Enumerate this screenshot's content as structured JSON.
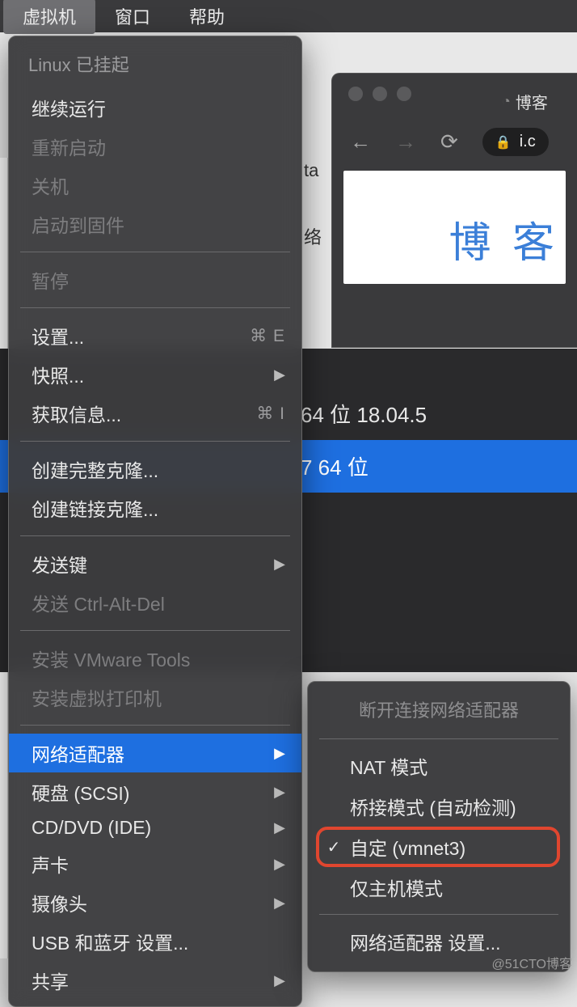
{
  "menubar": {
    "vm": "虚拟机",
    "window": "窗口",
    "help": "帮助"
  },
  "browser": {
    "tab_title": "博客",
    "address": "i.c",
    "content_logo": "博 客"
  },
  "vmlist": {
    "row1": "64 位 18.04.5",
    "row2": "7 64 位"
  },
  "behind": {
    "t1": "ta",
    "t2": "络"
  },
  "menu": {
    "header": "Linux 已挂起",
    "resume": "继续运行",
    "restart": "重新启动",
    "shutdown": "关机",
    "boot_firmware": "启动到固件",
    "pause": "暂停",
    "settings": "设置...",
    "snapshot": "快照...",
    "get_info": "获取信息...",
    "full_clone": "创建完整克隆...",
    "linked_clone": "创建链接克隆...",
    "send_key": "发送键",
    "send_cad": "发送 Ctrl-Alt-Del",
    "install_tools": "安装 VMware Tools",
    "install_printer": "安装虚拟打印机",
    "network_adapter": "网络适配器",
    "hard_disk": "硬盘 (SCSI)",
    "cd_dvd": "CD/DVD (IDE)",
    "sound": "声卡",
    "camera": "摄像头",
    "usb_bt": "USB 和蓝牙 设置...",
    "sharing": "共享",
    "shortcut_settings": "⌘ E",
    "shortcut_info": "⌘ I"
  },
  "submenu": {
    "header": "断开连接网络适配器",
    "nat": "NAT 模式",
    "bridged": "桥接模式 (自动检测)",
    "custom": "自定 (vmnet3)",
    "hostonly": "仅主机模式",
    "settings": "网络适配器 设置..."
  },
  "watermark": "@51CTO博客"
}
